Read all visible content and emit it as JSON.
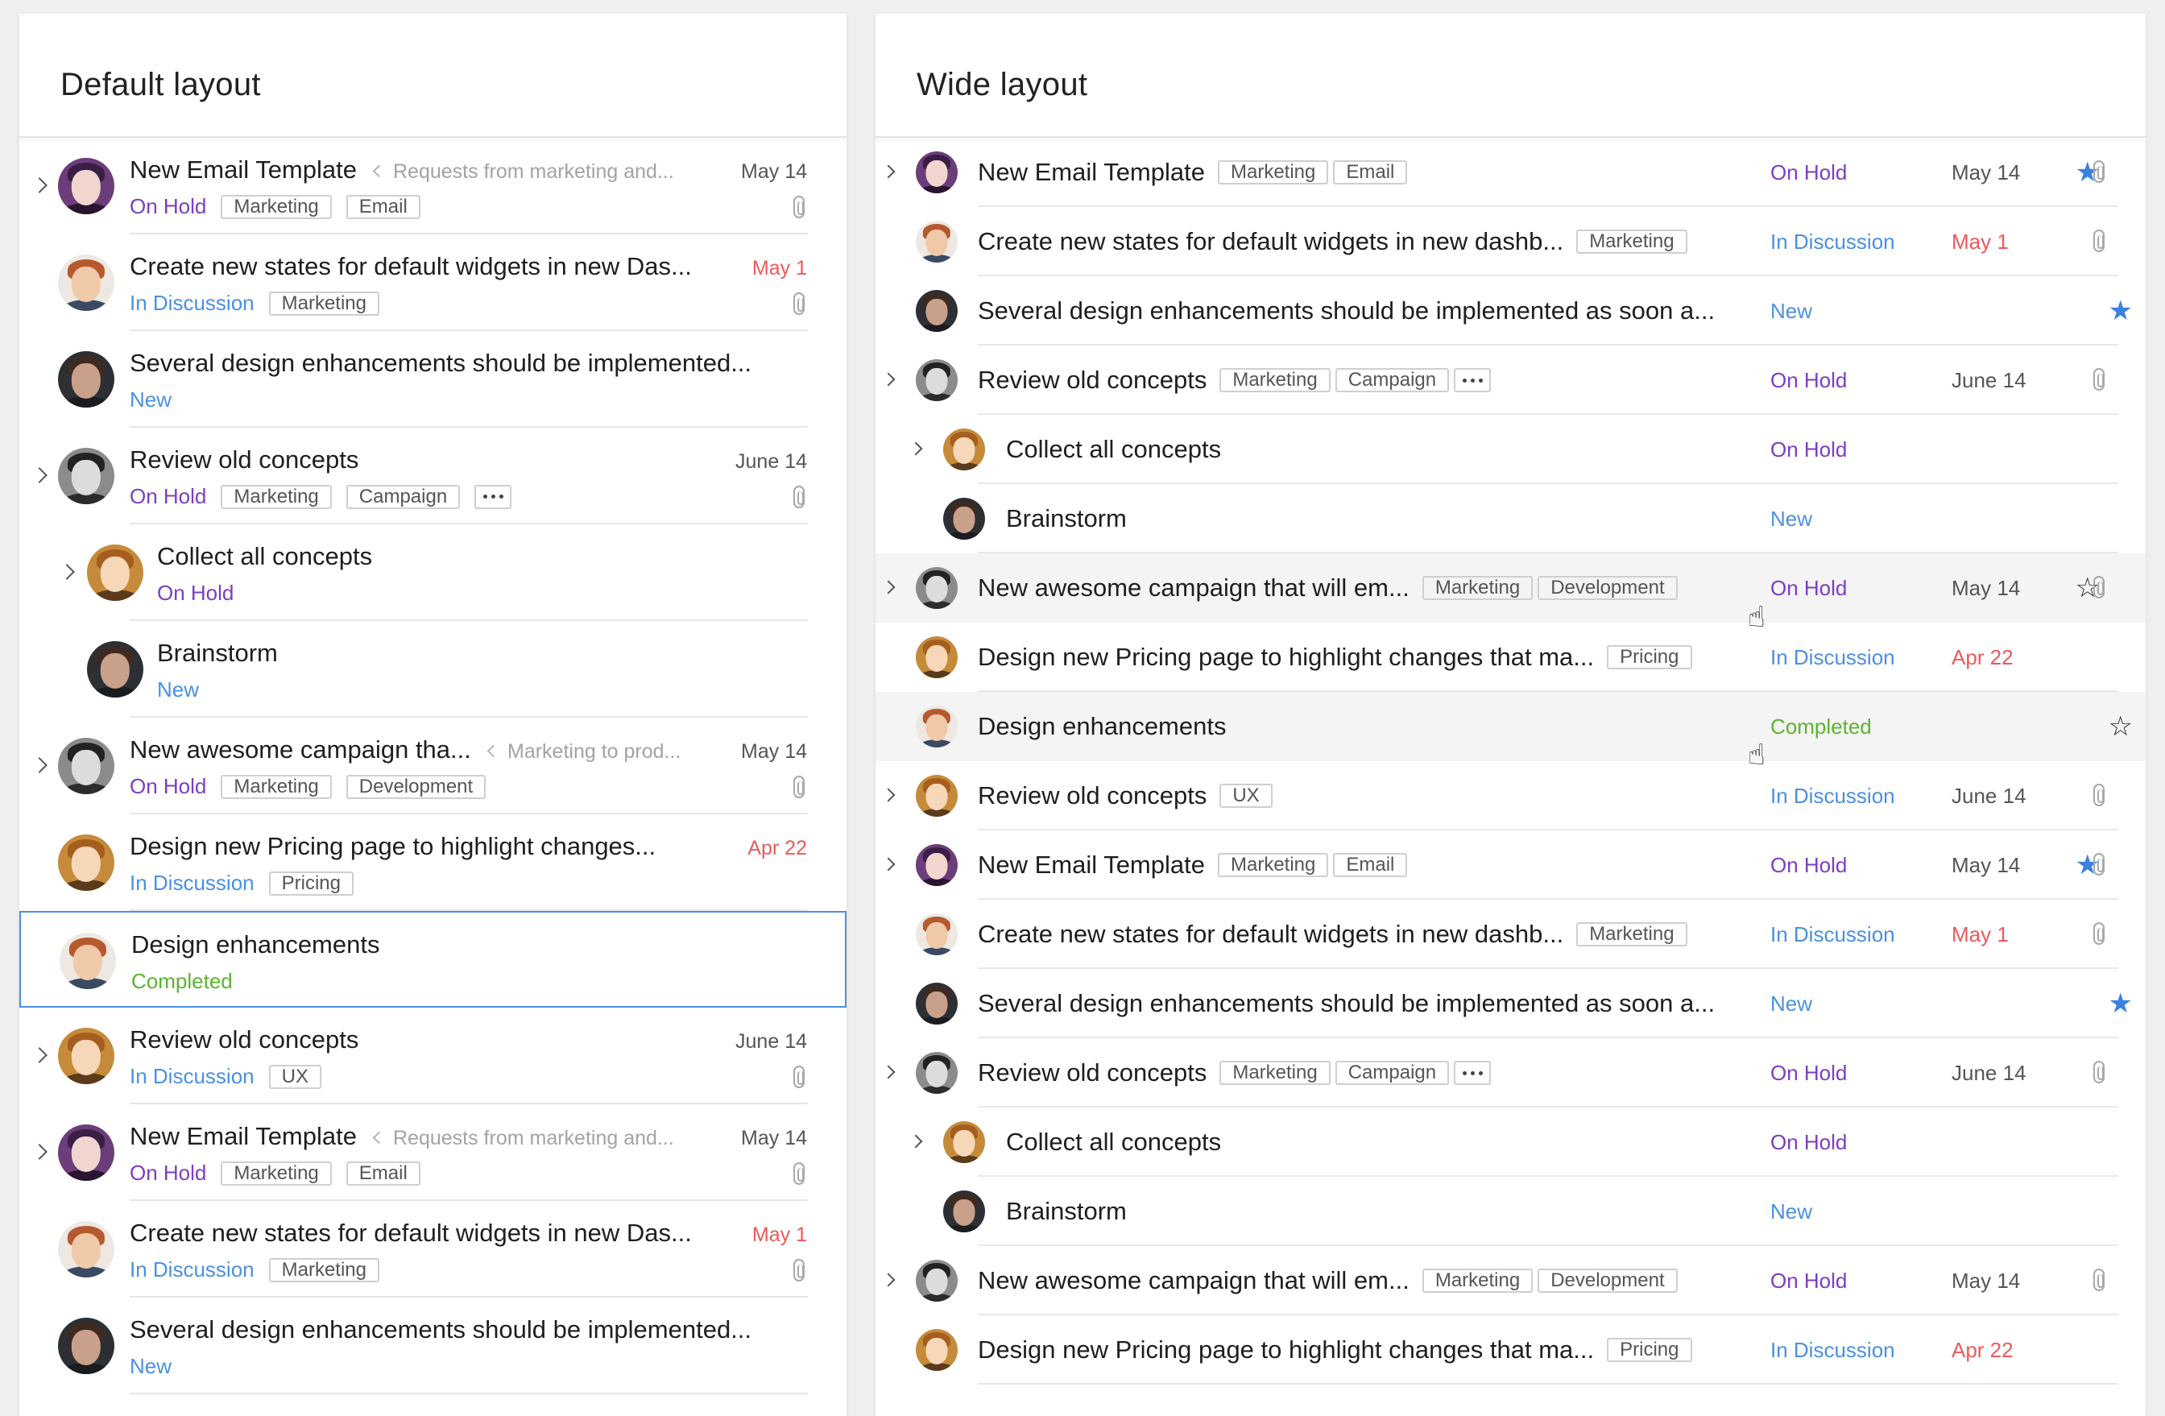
{
  "default_panel": {
    "title": "Default layout",
    "rows": [
      {
        "title": "New Email Template",
        "parent": "Requests from marketing and...",
        "date": "May 14",
        "date_red": false,
        "status": "On Hold",
        "status_type": "onhold",
        "tags": [
          "Marketing",
          "Email"
        ],
        "dots": false,
        "attachment": true,
        "chevron": true,
        "avatar": "purple",
        "sub": false,
        "selected": false
      },
      {
        "title": "Create new states for default widgets in new Das...",
        "parent": "",
        "date": "May 1",
        "date_red": true,
        "status": "In Discussion",
        "status_type": "discussion",
        "tags": [
          "Marketing"
        ],
        "dots": false,
        "attachment": true,
        "chevron": false,
        "avatar": "light",
        "sub": false,
        "selected": false
      },
      {
        "title": "Several design enhancements should be implemented...",
        "parent": "",
        "date": "",
        "date_red": false,
        "status": "New",
        "status_type": "new",
        "tags": [],
        "dots": false,
        "attachment": false,
        "chevron": false,
        "avatar": "dark",
        "sub": false,
        "selected": false
      },
      {
        "title": "Review old concepts",
        "parent": "",
        "date": "June 14",
        "date_red": false,
        "status": "On Hold",
        "status_type": "onhold",
        "tags": [
          "Marketing",
          "Campaign"
        ],
        "dots": true,
        "attachment": true,
        "chevron": true,
        "avatar": "gray",
        "sub": false,
        "selected": false
      },
      {
        "title": "Collect all concepts",
        "parent": "",
        "date": "",
        "date_red": false,
        "status": "On Hold",
        "status_type": "onhold",
        "tags": [],
        "dots": false,
        "attachment": false,
        "chevron": true,
        "avatar": "blond",
        "sub": true,
        "selected": false
      },
      {
        "title": "Brainstorm",
        "parent": "",
        "date": "",
        "date_red": false,
        "status": "New",
        "status_type": "new",
        "tags": [],
        "dots": false,
        "attachment": false,
        "chevron": false,
        "avatar": "dark",
        "sub": true,
        "selected": false
      },
      {
        "title": "New awesome campaign tha...",
        "parent": "Marketing to prod...",
        "date": "May 14",
        "date_red": false,
        "status": "On Hold",
        "status_type": "onhold",
        "tags": [
          "Marketing",
          "Development"
        ],
        "dots": false,
        "attachment": true,
        "chevron": true,
        "avatar": "gray",
        "sub": false,
        "selected": false
      },
      {
        "title": "Design new Pricing page to highlight changes...",
        "parent": "",
        "date": "Apr 22",
        "date_red": true,
        "status": "In Discussion",
        "status_type": "discussion",
        "tags": [
          "Pricing"
        ],
        "dots": false,
        "attachment": false,
        "chevron": false,
        "avatar": "blond",
        "sub": false,
        "selected": false
      },
      {
        "title": "Design enhancements",
        "parent": "",
        "date": "",
        "date_red": false,
        "status": "Completed",
        "status_type": "completed",
        "tags": [],
        "dots": false,
        "attachment": false,
        "chevron": false,
        "avatar": "light",
        "sub": false,
        "selected": true
      },
      {
        "title": "Review old concepts",
        "parent": "",
        "date": "June 14",
        "date_red": false,
        "status": "In Discussion",
        "status_type": "discussion",
        "tags": [
          "UX"
        ],
        "dots": false,
        "attachment": true,
        "chevron": true,
        "avatar": "blond",
        "sub": false,
        "selected": false
      },
      {
        "title": "New Email Template",
        "parent": "Requests from marketing and...",
        "date": "May 14",
        "date_red": false,
        "status": "On Hold",
        "status_type": "onhold",
        "tags": [
          "Marketing",
          "Email"
        ],
        "dots": false,
        "attachment": true,
        "chevron": true,
        "avatar": "purple",
        "sub": false,
        "selected": false
      },
      {
        "title": "Create new states for default widgets in new Das...",
        "parent": "",
        "date": "May 1",
        "date_red": true,
        "status": "In Discussion",
        "status_type": "discussion",
        "tags": [
          "Marketing"
        ],
        "dots": false,
        "attachment": true,
        "chevron": false,
        "avatar": "light",
        "sub": false,
        "selected": false
      },
      {
        "title": "Several design enhancements should be implemented...",
        "parent": "",
        "date": "",
        "date_red": false,
        "status": "New",
        "status_type": "new",
        "tags": [],
        "dots": false,
        "attachment": false,
        "chevron": false,
        "avatar": "dark",
        "sub": false,
        "selected": false
      }
    ]
  },
  "wide_panel": {
    "title": "Wide layout",
    "rows": [
      {
        "title": "New Email Template",
        "tags": [
          "Marketing",
          "Email"
        ],
        "dots": false,
        "status": "On Hold",
        "status_type": "onhold",
        "date": "May 14",
        "date_red": false,
        "star": "filled",
        "attachment": true,
        "chevron": true,
        "avatar": "purple",
        "sub": false,
        "hover": false
      },
      {
        "title": "Create new states for default widgets in new dashb...",
        "tags": [
          "Marketing"
        ],
        "dots": false,
        "status": "In Discussion",
        "status_type": "discussion",
        "date": "May 1",
        "date_red": true,
        "star": "",
        "attachment": true,
        "chevron": false,
        "avatar": "light",
        "sub": false,
        "hover": false
      },
      {
        "title": "Several design enhancements should be implemented as soon a...",
        "tags": [],
        "dots": false,
        "status": "New",
        "status_type": "new",
        "date": "",
        "date_red": false,
        "star": "filled",
        "attachment": false,
        "chevron": false,
        "avatar": "dark",
        "sub": false,
        "hover": false
      },
      {
        "title": "Review old concepts",
        "tags": [
          "Marketing",
          "Campaign"
        ],
        "dots": true,
        "status": "On Hold",
        "status_type": "onhold",
        "date": "June 14",
        "date_red": false,
        "star": "",
        "attachment": true,
        "chevron": true,
        "avatar": "gray",
        "sub": false,
        "hover": false
      },
      {
        "title": "Collect all concepts",
        "tags": [],
        "dots": false,
        "status": "On Hold",
        "status_type": "onhold",
        "date": "",
        "date_red": false,
        "star": "",
        "attachment": false,
        "chevron": true,
        "avatar": "blond",
        "sub": true,
        "hover": false
      },
      {
        "title": "Brainstorm",
        "tags": [],
        "dots": false,
        "status": "New",
        "status_type": "new",
        "date": "",
        "date_red": false,
        "star": "",
        "attachment": false,
        "chevron": false,
        "avatar": "dark",
        "sub": true,
        "hover": false
      },
      {
        "title": "New awesome campaign that will em...",
        "tags": [
          "Marketing",
          "Development"
        ],
        "dots": false,
        "status": "On Hold",
        "status_type": "onhold",
        "date": "May 14",
        "date_red": false,
        "star": "outline",
        "attachment": true,
        "chevron": true,
        "avatar": "gray",
        "sub": false,
        "hover": true
      },
      {
        "title": "Design new Pricing page to highlight changes that ma...",
        "tags": [
          "Pricing"
        ],
        "dots": false,
        "status": "In Discussion",
        "status_type": "discussion",
        "date": "Apr 22",
        "date_red": true,
        "star": "",
        "attachment": false,
        "chevron": false,
        "avatar": "blond",
        "sub": false,
        "hover": false
      },
      {
        "title": "Design enhancements",
        "tags": [],
        "dots": false,
        "status": "Completed",
        "status_type": "completed",
        "date": "",
        "date_red": false,
        "star": "outline",
        "attachment": false,
        "chevron": false,
        "avatar": "light",
        "sub": false,
        "hover": true
      },
      {
        "title": "Review old concepts",
        "tags": [
          "UX"
        ],
        "dots": false,
        "status": "In Discussion",
        "status_type": "discussion",
        "date": "June 14",
        "date_red": false,
        "star": "",
        "attachment": true,
        "chevron": true,
        "avatar": "blond",
        "sub": false,
        "hover": false
      },
      {
        "title": "New Email Template",
        "tags": [
          "Marketing",
          "Email"
        ],
        "dots": false,
        "status": "On Hold",
        "status_type": "onhold",
        "date": "May 14",
        "date_red": false,
        "star": "filled",
        "attachment": true,
        "chevron": true,
        "avatar": "purple",
        "sub": false,
        "hover": false
      },
      {
        "title": "Create new states for default widgets in new dashb...",
        "tags": [
          "Marketing"
        ],
        "dots": false,
        "status": "In Discussion",
        "status_type": "discussion",
        "date": "May 1",
        "date_red": true,
        "star": "",
        "attachment": true,
        "chevron": false,
        "avatar": "light",
        "sub": false,
        "hover": false
      },
      {
        "title": "Several design enhancements should be implemented as soon a...",
        "tags": [],
        "dots": false,
        "status": "New",
        "status_type": "new",
        "date": "",
        "date_red": false,
        "star": "filled",
        "attachment": false,
        "chevron": false,
        "avatar": "dark",
        "sub": false,
        "hover": false
      },
      {
        "title": "Review old concepts",
        "tags": [
          "Marketing",
          "Campaign"
        ],
        "dots": true,
        "status": "On Hold",
        "status_type": "onhold",
        "date": "June 14",
        "date_red": false,
        "star": "",
        "attachment": true,
        "chevron": true,
        "avatar": "gray",
        "sub": false,
        "hover": false
      },
      {
        "title": "Collect all concepts",
        "tags": [],
        "dots": false,
        "status": "On Hold",
        "status_type": "onhold",
        "date": "",
        "date_red": false,
        "star": "",
        "attachment": false,
        "chevron": true,
        "avatar": "blond",
        "sub": true,
        "hover": false
      },
      {
        "title": "Brainstorm",
        "tags": [],
        "dots": false,
        "status": "New",
        "status_type": "new",
        "date": "",
        "date_red": false,
        "star": "",
        "attachment": false,
        "chevron": false,
        "avatar": "dark",
        "sub": true,
        "hover": false
      },
      {
        "title": "New awesome campaign that will em...",
        "tags": [
          "Marketing",
          "Development"
        ],
        "dots": false,
        "status": "On Hold",
        "status_type": "onhold",
        "date": "May 14",
        "date_red": false,
        "star": "",
        "attachment": true,
        "chevron": true,
        "avatar": "gray",
        "sub": false,
        "hover": false
      },
      {
        "title": "Design new Pricing page to highlight changes that ma...",
        "tags": [
          "Pricing"
        ],
        "dots": false,
        "status": "In Discussion",
        "status_type": "discussion",
        "date": "Apr 22",
        "date_red": true,
        "star": "",
        "attachment": false,
        "chevron": false,
        "avatar": "blond",
        "sub": false,
        "hover": false
      }
    ]
  },
  "icons": {
    "star_filled": "★",
    "star_outline": "☆",
    "cursor": "pointer-hand-icon"
  },
  "colors": {
    "on_hold": "#7b3fc2",
    "in_discussion": "#4a90e2",
    "new": "#4a90e2",
    "completed": "#5cb431",
    "overdue_date": "#ec5a5a",
    "star": "#3b82e0",
    "selection_border": "#4a90e2"
  }
}
